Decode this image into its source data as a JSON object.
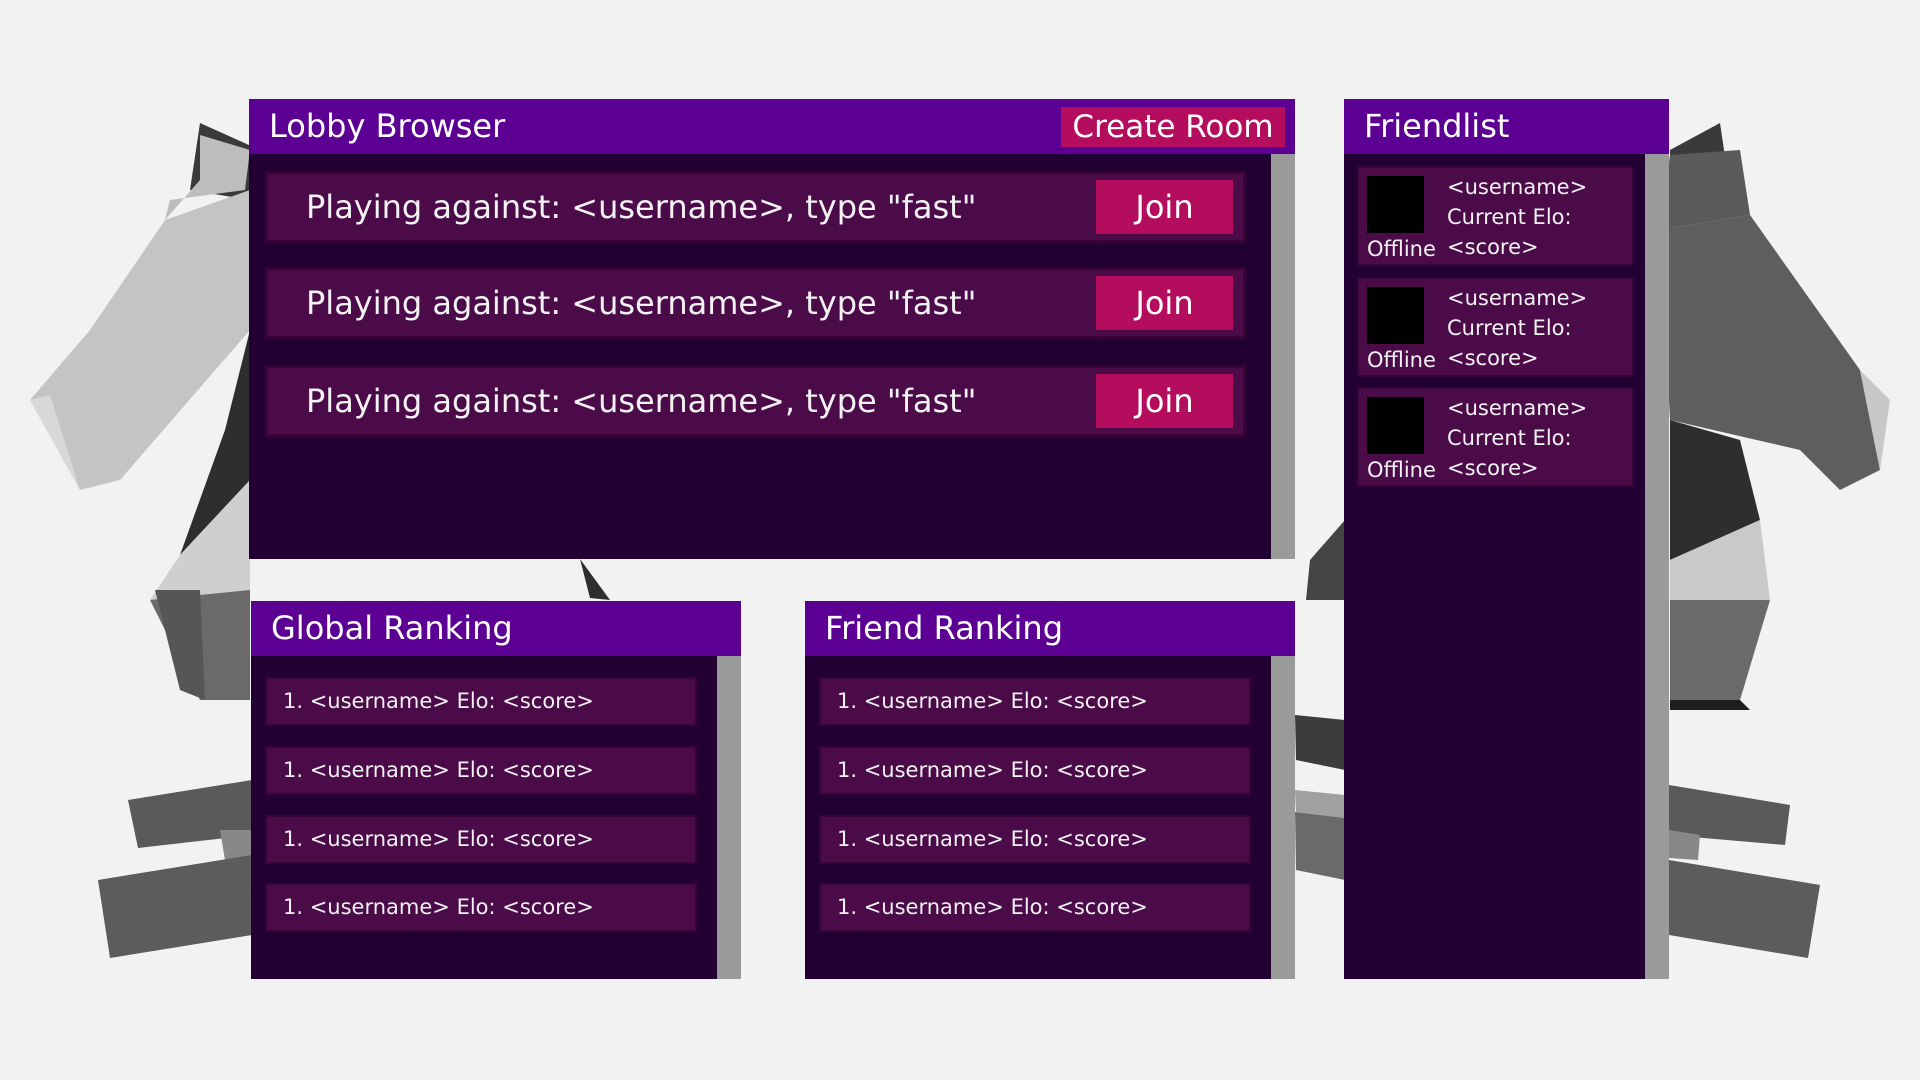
{
  "lobby": {
    "title": "Lobby Browser",
    "create_button": "Create Room",
    "rooms": [
      {
        "text": "Playing against: <username>, type \"fast\"",
        "join_label": "Join"
      },
      {
        "text": "Playing against: <username>, type \"fast\"",
        "join_label": "Join"
      },
      {
        "text": "Playing against: <username>, type \"fast\"",
        "join_label": "Join"
      }
    ]
  },
  "global_ranking": {
    "title": "Global Ranking",
    "entries": [
      "1. <username> Elo: <score>",
      "1. <username> Elo: <score>",
      "1. <username> Elo: <score>",
      "1. <username> Elo: <score>"
    ]
  },
  "friend_ranking": {
    "title": "Friend Ranking",
    "entries": [
      "1. <username> Elo: <score>",
      "1. <username> Elo: <score>",
      "1. <username> Elo: <score>",
      "1. <username> Elo: <score>"
    ]
  },
  "friendlist": {
    "title": "Friendlist",
    "friends": [
      {
        "status": "Offline",
        "username": "<username>",
        "elo_label": "Current Elo:",
        "score": "<score>"
      },
      {
        "status": "Offline",
        "username": "<username>",
        "elo_label": "Current Elo:",
        "score": "<score>"
      },
      {
        "status": "Offline",
        "username": "<username>",
        "elo_label": "Current Elo:",
        "score": "<score>"
      }
    ]
  },
  "colors": {
    "background": "#f2f2f2",
    "panel": "#220033",
    "header": "#5b0093",
    "row": "#4b0b49",
    "button": "#b40d5e",
    "scrollbar": "#9a9a9a"
  }
}
